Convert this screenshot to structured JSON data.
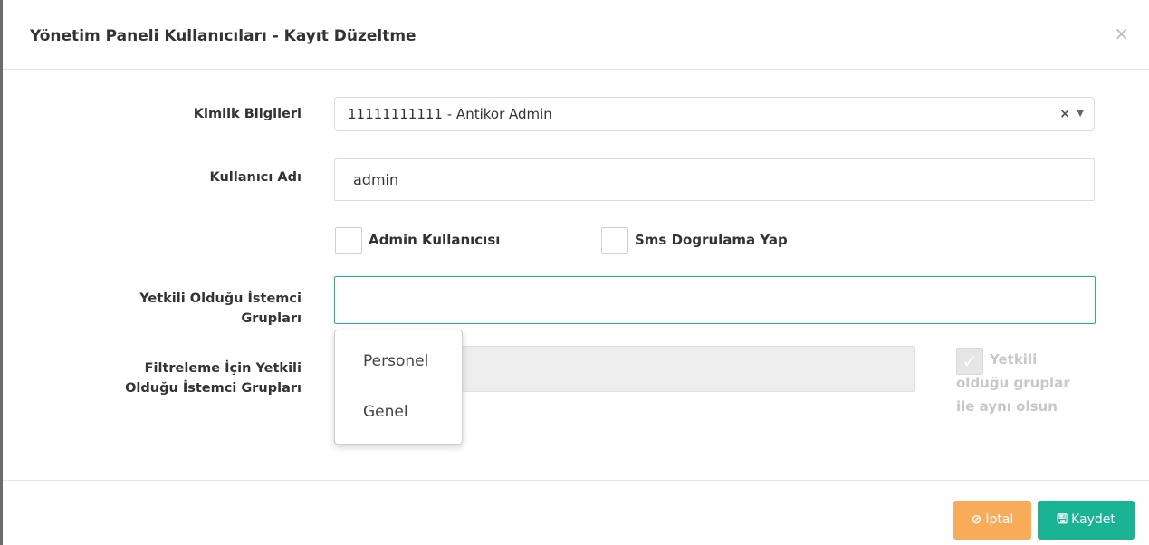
{
  "modal": {
    "title": "Yönetim Paneli Kullanıcıları - Kayıt Düzeltme",
    "close_icon": "×"
  },
  "form": {
    "identity": {
      "label": "Kimlik Bilgileri",
      "value": "11111111111 - Antikor Admin",
      "clear_icon": "×",
      "arrow_icon": "▼"
    },
    "username": {
      "label": "Kullanıcı Adı",
      "value": "admin"
    },
    "admin_user": {
      "label": "Admin Kullanıcısı"
    },
    "sms_verify": {
      "label": "Sms Dogrulama Yap"
    },
    "client_groups": {
      "label_line1": "Yetkili Olduğu İstemci",
      "label_line2": "Grupları",
      "value": ""
    },
    "filter_groups": {
      "label_line1": "Filtreleme İçin Yetkili",
      "label_line2": "Olduğu İstemci Grupları"
    },
    "same_groups": {
      "check_icon": "✓",
      "label": "Yetkili olduğu gruplar ile aynı olsun"
    }
  },
  "dropdown": {
    "options": [
      "Personel",
      "Genel"
    ]
  },
  "footer": {
    "cancel_icon": "⊘",
    "cancel_label": "İptal",
    "save_icon": "🖫",
    "save_label": "Kaydet"
  },
  "colors": {
    "primary": "#1ab394",
    "warning": "#f8ac59"
  }
}
